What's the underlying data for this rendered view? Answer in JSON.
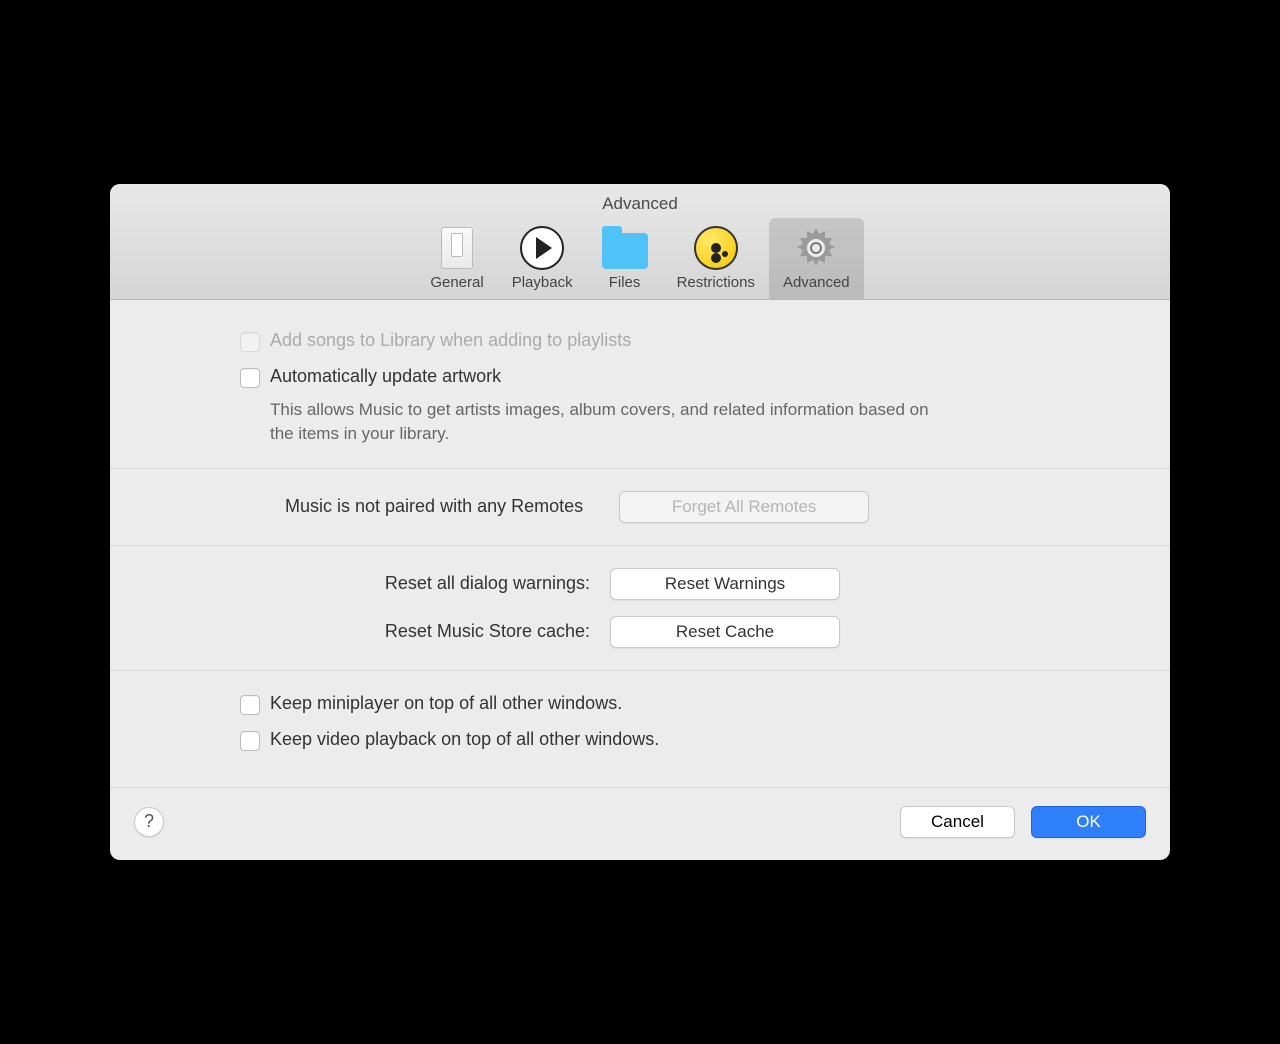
{
  "window": {
    "title": "Advanced"
  },
  "tabs": [
    {
      "label": "General"
    },
    {
      "label": "Playback"
    },
    {
      "label": "Files"
    },
    {
      "label": "Restrictions"
    },
    {
      "label": "Advanced"
    }
  ],
  "options": {
    "add_songs": "Add songs to Library when adding to playlists",
    "auto_artwork": "Automatically update artwork",
    "auto_artwork_desc": "This allows Music to get artists images, album covers, and related information based on the items in your library.",
    "remotes_status": "Music is not paired with any Remotes",
    "forget_remotes": "Forget All Remotes",
    "reset_warnings_label": "Reset all dialog warnings:",
    "reset_warnings_btn": "Reset Warnings",
    "reset_cache_label": "Reset Music Store cache:",
    "reset_cache_btn": "Reset Cache",
    "keep_miniplayer": "Keep miniplayer on top of all other windows.",
    "keep_video": "Keep video playback on top of all other windows."
  },
  "footer": {
    "help": "?",
    "cancel": "Cancel",
    "ok": "OK"
  }
}
